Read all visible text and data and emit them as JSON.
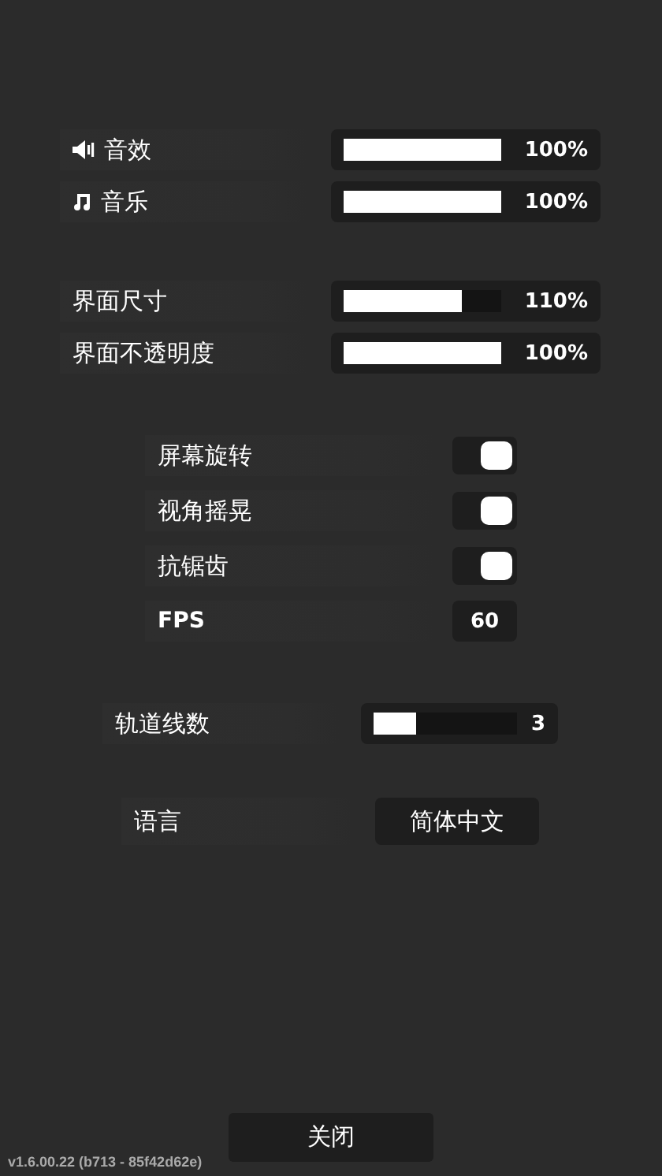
{
  "audio": [
    {
      "label": "音效",
      "level": 1,
      "reading": "100%"
    },
    {
      "label": "音乐",
      "level": 1,
      "reading": "100%"
    }
  ],
  "interface": [
    {
      "label": "界面尺寸",
      "level": 0.75,
      "reading": "110%"
    },
    {
      "label": "界面不透明度",
      "level": 1,
      "reading": "100%"
    }
  ],
  "options": [
    {
      "label": "屏幕旋转",
      "kind": "toggle",
      "on": true
    },
    {
      "label": "视角摇晃",
      "kind": "toggle",
      "on": true
    },
    {
      "label": "抗锯齿",
      "kind": "toggle",
      "on": true
    },
    {
      "label": "FPS",
      "kind": "value",
      "value": "60"
    }
  ],
  "track_lines": {
    "label": "轨道线数",
    "level": 0.3,
    "reading": "3"
  },
  "language": {
    "label": "语言",
    "value": "简体中文"
  },
  "close_button": "关闭",
  "version": "v1.6.00.22 (b713 - 85f42d62e)"
}
